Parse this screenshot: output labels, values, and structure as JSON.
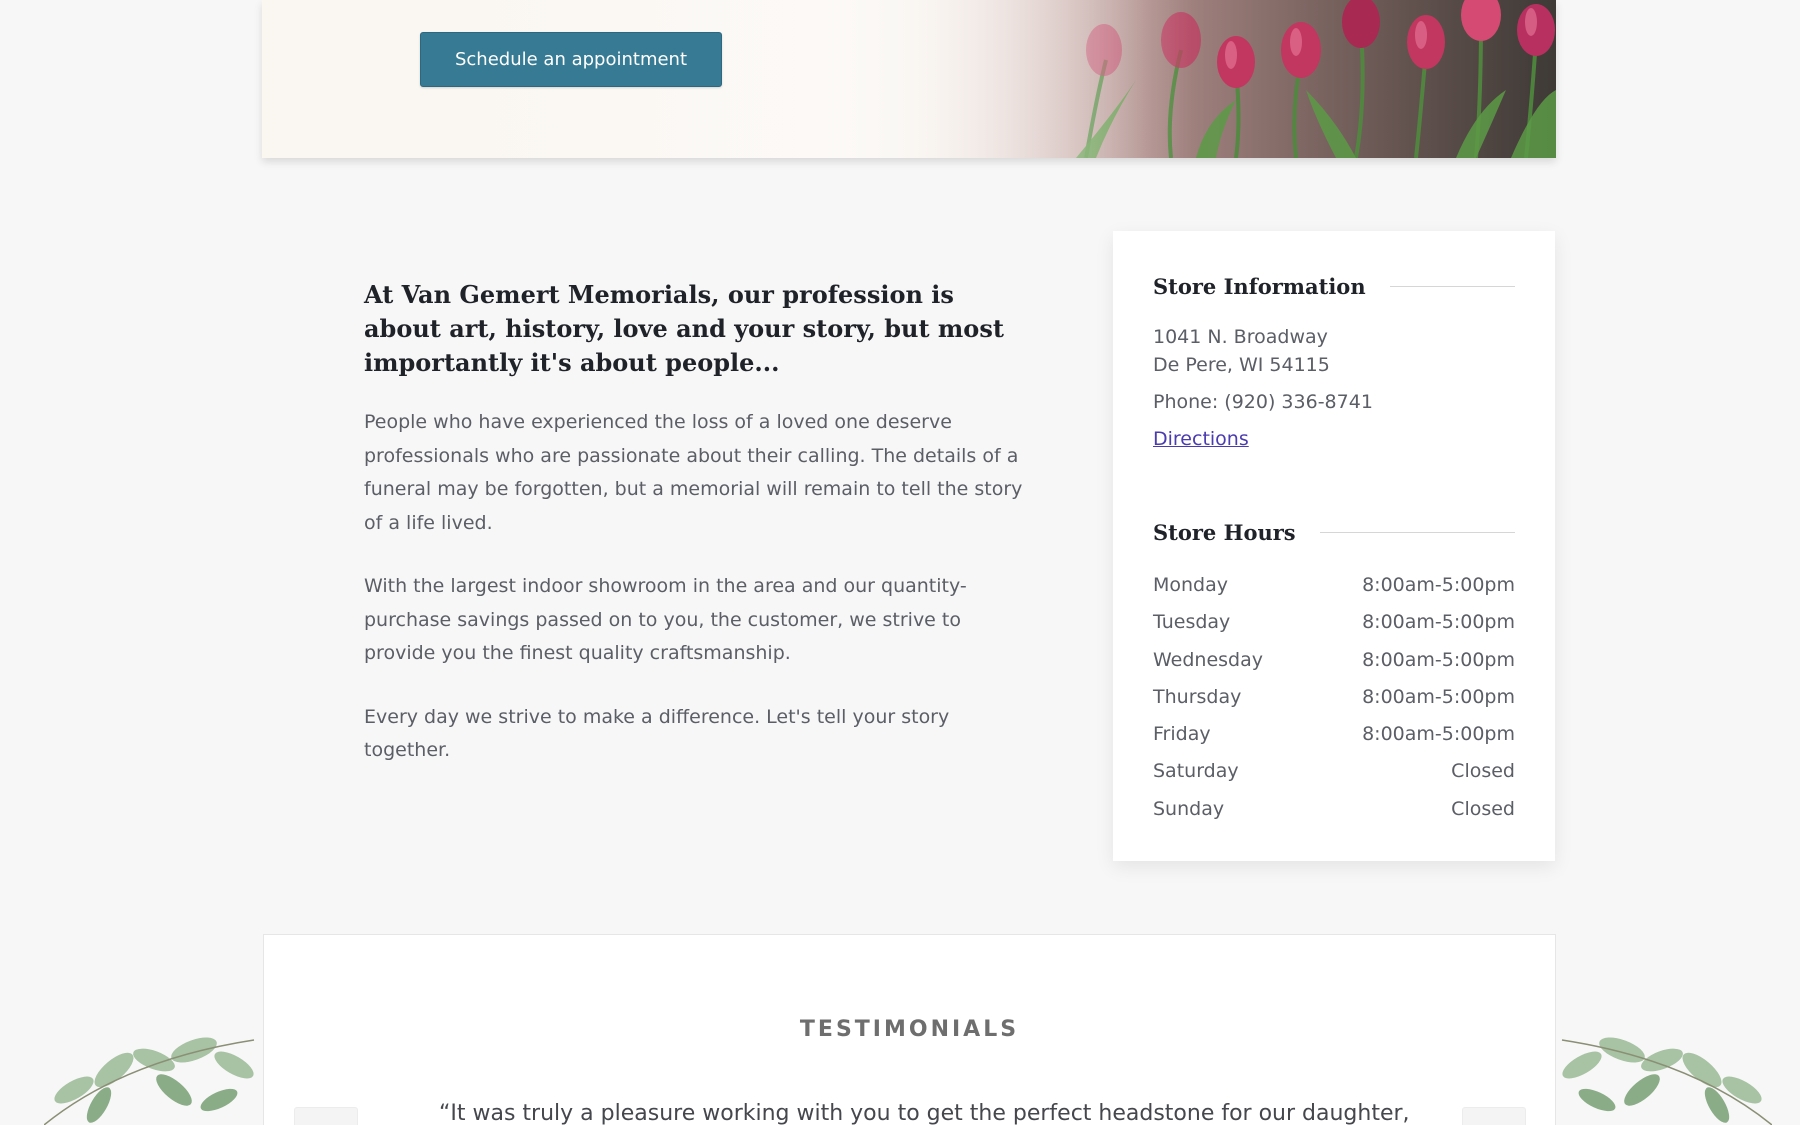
{
  "hero": {
    "appointment_button": "Schedule an appointment"
  },
  "intro": {
    "heading": "At Van Gemert Memorials, our profession is about art, history, love and your story, but most importantly it's about people...",
    "paragraphs": [
      "People who have experienced the loss of a loved one deserve professionals who are passionate about their calling. The details of a funeral may be forgotten, but a memorial will remain to tell the story of a life lived.",
      "With the largest indoor showroom in the area and our quantity-purchase savings passed on to you, the customer, we strive to provide you the finest quality craftsmanship.",
      "Every day we strive to make a difference. Let's tell your story together."
    ]
  },
  "store_info": {
    "heading": "Store Information",
    "address_line1": "1041 N. Broadway",
    "address_line2": "De Pere, WI 54115",
    "phone": "Phone: (920) 336-8741",
    "directions_label": "Directions"
  },
  "store_hours": {
    "heading": "Store Hours",
    "rows": [
      {
        "day": "Monday",
        "hours": "8:00am-5:00pm"
      },
      {
        "day": "Tuesday",
        "hours": "8:00am-5:00pm"
      },
      {
        "day": "Wednesday",
        "hours": "8:00am-5:00pm"
      },
      {
        "day": "Thursday",
        "hours": "8:00am-5:00pm"
      },
      {
        "day": "Friday",
        "hours": "8:00am-5:00pm"
      },
      {
        "day": "Saturday",
        "hours": "Closed"
      },
      {
        "day": "Sunday",
        "hours": "Closed"
      }
    ]
  },
  "testimonials": {
    "heading": "TESTIMONIALS",
    "quote": "“It was truly a pleasure working with you to get the perfect headstone for our daughter,"
  },
  "colors": {
    "button": "#367a94",
    "link": "#4b3bb0",
    "heading": "#1f2228",
    "body_text": "#5b5e66",
    "background": "#f7f7f7"
  },
  "icons": {
    "prev": "chevron-left-icon",
    "next": "chevron-right-icon",
    "decoration": "leaves"
  }
}
